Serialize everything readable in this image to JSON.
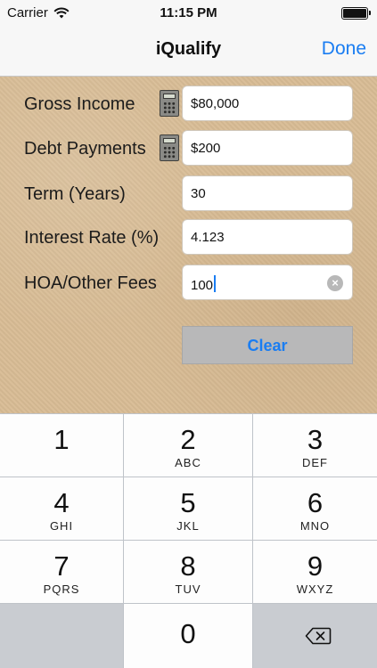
{
  "status": {
    "carrier": "Carrier",
    "time": "11:15 PM"
  },
  "nav": {
    "title": "iQualify",
    "done": "Done"
  },
  "form": {
    "rows": [
      {
        "label": "Gross Income",
        "value": "$80,000"
      },
      {
        "label": "Debt Payments",
        "value": "$200"
      },
      {
        "label": "Term (Years)",
        "value": "30"
      },
      {
        "label": "Interest Rate (%)",
        "value": "4.123"
      },
      {
        "label": "HOA/Other Fees",
        "value": "100"
      }
    ],
    "clear_label": "Clear"
  },
  "keypad": {
    "keys": [
      {
        "digit": "1",
        "letters": ""
      },
      {
        "digit": "2",
        "letters": "ABC"
      },
      {
        "digit": "3",
        "letters": "DEF"
      },
      {
        "digit": "4",
        "letters": "GHI"
      },
      {
        "digit": "5",
        "letters": "JKL"
      },
      {
        "digit": "6",
        "letters": "MNO"
      },
      {
        "digit": "7",
        "letters": "PQRS"
      },
      {
        "digit": "8",
        "letters": "TUV"
      },
      {
        "digit": "9",
        "letters": "WXYZ"
      },
      {
        "digit": "0",
        "letters": ""
      }
    ]
  },
  "icons": {
    "wifi": "wifi-icon",
    "battery": "battery-icon",
    "calculator": "calculator-icon",
    "clear_text": "clear-text-icon",
    "backspace": "backspace-icon"
  },
  "colors": {
    "accent": "#1a7df2",
    "form_background": "#d8bc95"
  }
}
